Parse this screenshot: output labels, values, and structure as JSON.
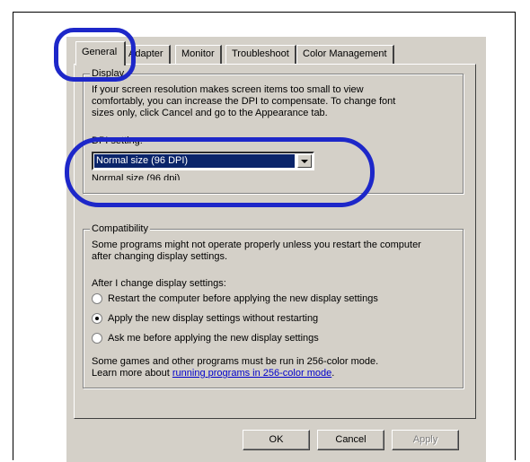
{
  "tabs": [
    {
      "label": "General",
      "active": true
    },
    {
      "label": "Adapter"
    },
    {
      "label": "Monitor"
    },
    {
      "label": "Troubleshoot"
    },
    {
      "label": "Color Management"
    }
  ],
  "display_group": {
    "legend": "Display",
    "description": "If your screen resolution makes screen items too small to view comfortably, you can increase the DPI to compensate.  To change font sizes only, click Cancel and go to the Appearance tab.",
    "dpi_label": "DPI setting:",
    "dpi_value": "Normal size (96 DPI)",
    "dpi_note": "Normal size (96 dpi)"
  },
  "compatibility_group": {
    "legend": "Compatibility",
    "description": "Some programs might not operate properly unless you restart the computer after changing display settings.",
    "after_change_label": "After I change display settings:",
    "options": [
      {
        "label": "Restart the computer before applying the new display settings",
        "checked": false
      },
      {
        "label": "Apply the new display settings without restarting",
        "checked": true
      },
      {
        "label": "Ask me before applying the new display settings",
        "checked": false
      }
    ],
    "footer_text": "Some games and other programs must be run in 256-color mode.",
    "learn_more_prefix": "Learn more about ",
    "learn_more_link": "running programs in 256-color mode",
    "learn_more_suffix": "."
  },
  "buttons": {
    "ok": "OK",
    "cancel": "Cancel",
    "apply": "Apply"
  },
  "colors": {
    "highlight": "#1d27c9",
    "selection": "#0a246a",
    "face": "#d4d0c8"
  }
}
